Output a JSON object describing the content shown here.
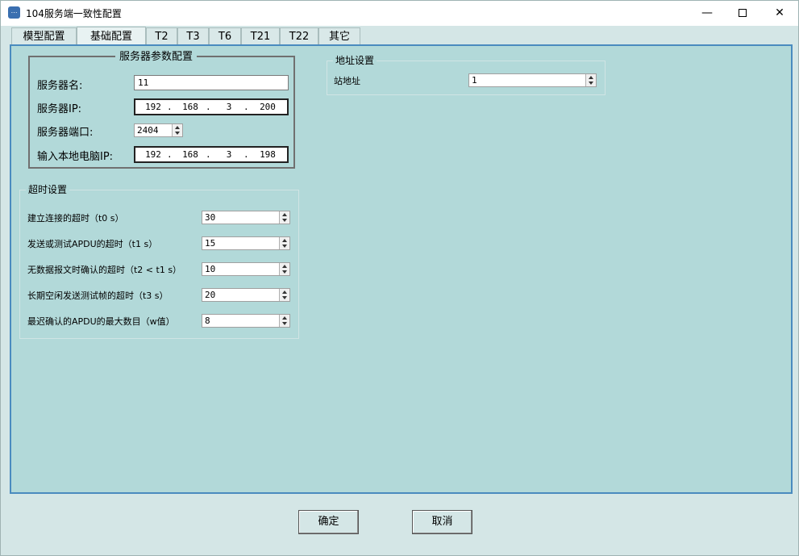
{
  "window": {
    "title": "104服务端一致性配置",
    "app_icon_glyph": "⋯"
  },
  "titlebar": {
    "minimize_glyph": "—",
    "close_glyph": "✕"
  },
  "tabs": [
    {
      "label": "模型配置",
      "active": false
    },
    {
      "label": "基础配置",
      "active": true
    },
    {
      "label": "T2",
      "active": false
    },
    {
      "label": "T3",
      "active": false
    },
    {
      "label": "T6",
      "active": false
    },
    {
      "label": "T21",
      "active": false
    },
    {
      "label": "T22",
      "active": false
    },
    {
      "label": "其它",
      "active": false
    }
  ],
  "server_group": {
    "title": "服务器参数配置",
    "name_label": "服务器名:",
    "name_value": "11",
    "ip_label": "服务器IP:",
    "ip": [
      "192",
      "168",
      "3",
      "200"
    ],
    "port_label": "服务器端口:",
    "port_value": "2404",
    "local_ip_label": "输入本地电脑IP:",
    "local_ip": [
      "192",
      "168",
      "3",
      "198"
    ],
    "ip_dot": "."
  },
  "address_group": {
    "title": "地址设置",
    "station_label": "站地址",
    "station_value": "1"
  },
  "timeout_group": {
    "title": "超时设置",
    "rows": [
      {
        "label": "建立连接的超时（t0 s）",
        "value": "30"
      },
      {
        "label": "发送或测试APDU的超时（t1 s）",
        "value": "15"
      },
      {
        "label": "无数据报文时确认的超时（t2 < t1 s）",
        "value": "10"
      },
      {
        "label": "长期空闲发送测试帧的超时（t3 s）",
        "value": "20"
      },
      {
        "label": "最迟确认的APDU的最大数目（w值）",
        "value": "8"
      }
    ]
  },
  "buttons": {
    "ok": "确定",
    "cancel": "取消"
  },
  "colors": {
    "panel_bg": "#b2d9d9",
    "window_bg": "#d4e6e6",
    "panel_border": "#4a8bbf"
  }
}
